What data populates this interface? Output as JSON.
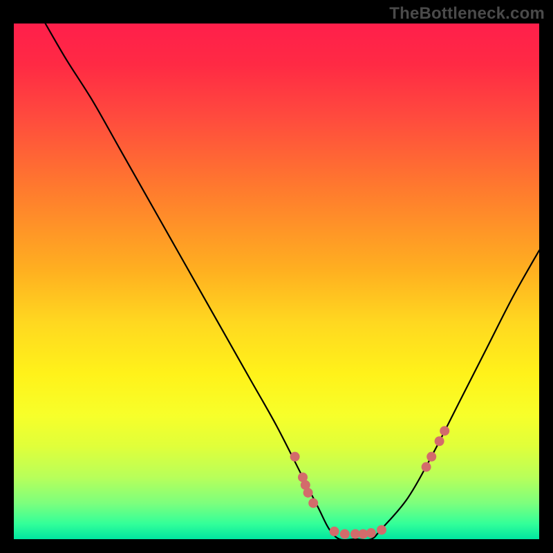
{
  "watermark": "TheBottleneck.com",
  "chart_data": {
    "type": "line",
    "title": "",
    "xlabel": "",
    "ylabel": "",
    "xlim": [
      0,
      100
    ],
    "ylim": [
      0,
      100
    ],
    "series": [
      {
        "name": "bottleneck-curve",
        "x": [
          6,
          10,
          15,
          20,
          25,
          30,
          35,
          40,
          45,
          50,
          55,
          58,
          60,
          62,
          65,
          68,
          70,
          75,
          80,
          85,
          90,
          95,
          100
        ],
        "y": [
          100,
          93,
          85,
          76,
          67,
          58,
          49,
          40,
          31,
          22,
          12,
          6,
          2,
          0,
          0,
          0,
          2,
          8,
          17,
          27,
          37,
          47,
          56
        ]
      }
    ],
    "markers": {
      "name": "highlight-points",
      "color": "#d36b6b",
      "x": [
        53.5,
        55,
        55.5,
        56,
        57,
        61,
        63,
        65,
        66.5,
        68,
        70,
        78.5,
        79.5,
        81,
        82
      ],
      "y": [
        16,
        12,
        10.5,
        9,
        7,
        1.5,
        1,
        1,
        1,
        1.2,
        1.8,
        14,
        16,
        19,
        21
      ]
    },
    "gradient_stops": [
      {
        "pos": 0,
        "color": "#ff1f4b"
      },
      {
        "pos": 100,
        "color": "#00e6a0"
      }
    ]
  }
}
